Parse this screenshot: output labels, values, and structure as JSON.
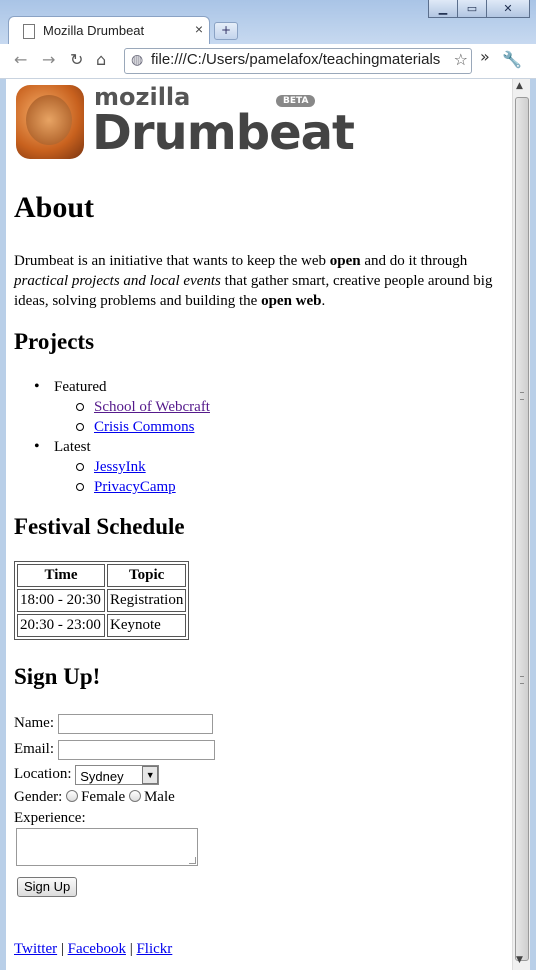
{
  "browser": {
    "tab_title": "Mozilla Drumbeat",
    "tab_close": "×",
    "new_tab": "+",
    "url": "file:///C:/Users/pamelafox/teachingmaterials",
    "overflow": "»",
    "window_controls": {
      "minimize": "▁",
      "maximize": "▭",
      "close": "✕"
    }
  },
  "logo": {
    "small": "mozilla",
    "big": "Drumbeat",
    "badge": "BETA"
  },
  "about": {
    "heading": "About",
    "text_1": "Drumbeat is an initiative that wants to keep the web ",
    "bold_1": "open",
    "text_2": " and do it through ",
    "italic_1": "practical projects and local events",
    "text_3": " that gather smart, creative people around big ideas, solving problems and building the ",
    "bold_2": "open web",
    "text_4": "."
  },
  "projects": {
    "heading": "Projects",
    "featured_label": "Featured",
    "featured": [
      "School of Webcraft",
      "Crisis Commons"
    ],
    "latest_label": "Latest",
    "latest": [
      "JessyInk",
      "PrivacyCamp"
    ]
  },
  "schedule": {
    "heading": "Festival Schedule",
    "columns": [
      "Time",
      "Topic"
    ],
    "rows": [
      [
        "18:00 - 20:30",
        "Registration"
      ],
      [
        "20:30 - 23:00",
        "Keynote"
      ]
    ]
  },
  "signup": {
    "heading": "Sign Up!",
    "name_label": "Name:",
    "email_label": "Email:",
    "location_label": "Location:",
    "location_value": "Sydney",
    "gender_label": "Gender:",
    "gender_options": [
      "Female",
      "Male"
    ],
    "experience_label": "Experience:",
    "submit": "Sign Up"
  },
  "footer": {
    "links": [
      "Twitter",
      "Facebook",
      "Flickr"
    ],
    "separator": "|"
  }
}
